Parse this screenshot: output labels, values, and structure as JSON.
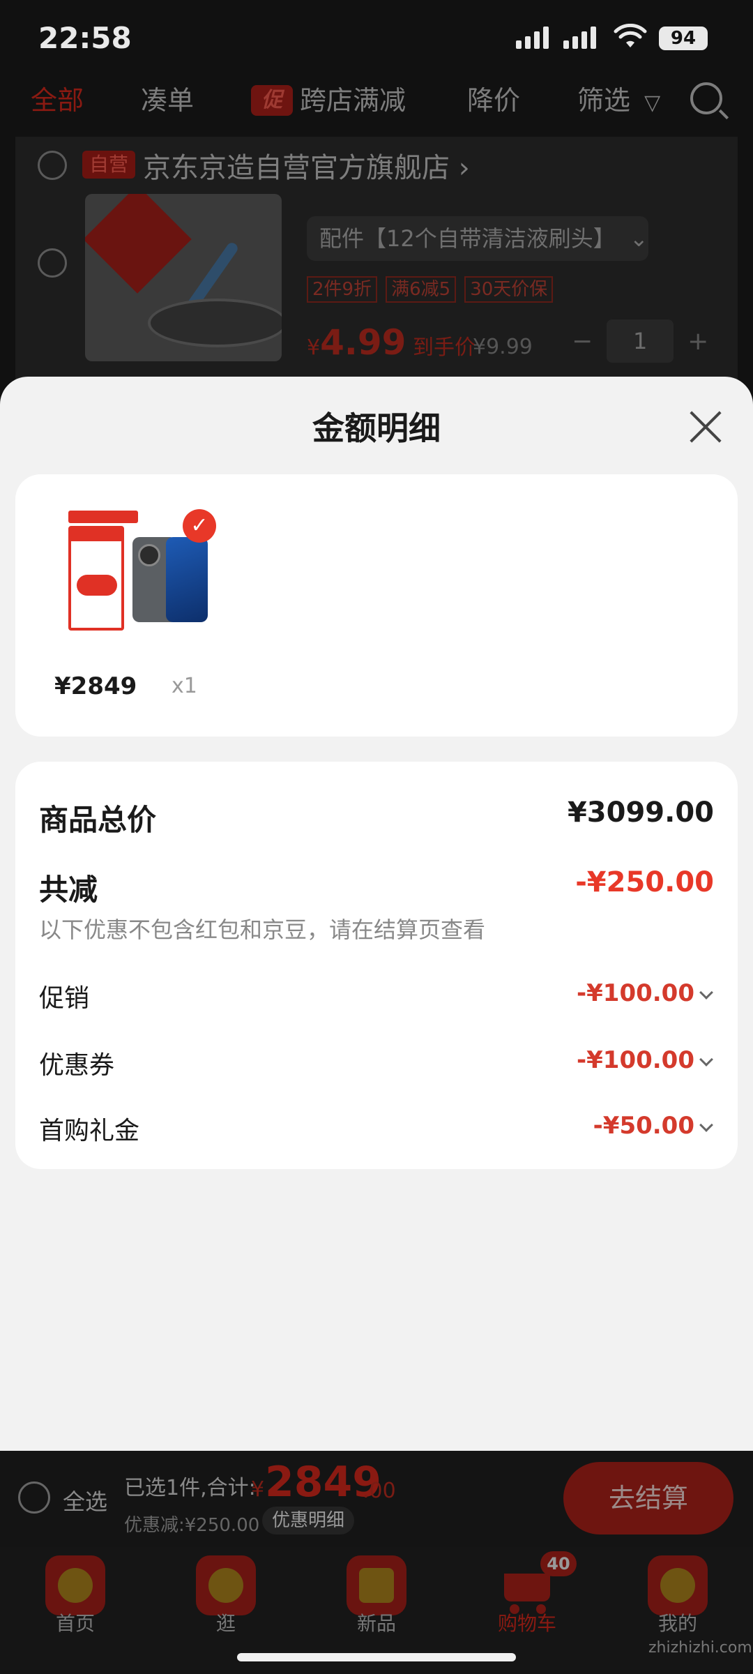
{
  "status_bar": {
    "time": "22:58",
    "battery": "94"
  },
  "top_tabs": [
    {
      "label": "全部"
    },
    {
      "label": "凑单"
    },
    {
      "label": "跨店满减",
      "tag": "促"
    },
    {
      "label": "降价"
    },
    {
      "label": "筛选"
    }
  ],
  "store": {
    "self_tag": "自营",
    "name": "京东京造自营官方旗舰店 ›",
    "product": {
      "spec": "配件【12个自带清洁液刷头】",
      "badges": [
        "2件9折",
        "满6减5",
        "30天价保"
      ],
      "price_prefix": "¥",
      "price_main": "4.99",
      "price_suffix": "到手价",
      "original_price": "¥9.99",
      "quantity": "1"
    }
  },
  "sheet": {
    "title": "金额明细",
    "item": {
      "price": "¥2849",
      "qty": "x1"
    },
    "summary": {
      "total_label": "商品总价",
      "total_value": "¥3099.00",
      "reduce_label": "共减",
      "reduce_value": "-¥250.00",
      "note": "以下优惠不包含红包和京豆，请在结算页查看",
      "rows": [
        {
          "label": "促销",
          "value": "-¥100.00"
        },
        {
          "label": "优惠券",
          "value": "-¥100.00"
        },
        {
          "label": "首购礼金",
          "value": "-¥50.00"
        }
      ]
    }
  },
  "checkout": {
    "select_all": "全选",
    "selected": "已选1件,合计:",
    "yen": "¥",
    "total_main": "2849",
    "total_decimal": ".00",
    "discount": "优惠减:¥250.00",
    "detail_button": "优惠明细",
    "checkout_button": "去结算"
  },
  "tabbar": [
    {
      "label": "首页"
    },
    {
      "label": "逛"
    },
    {
      "label": "新品"
    },
    {
      "label": "购物车",
      "badge": "40"
    },
    {
      "label": "我的"
    }
  ],
  "watermark": "zhizhizhi.com",
  "colors": {
    "accent_red": "#e83828",
    "sheet_bg": "#f2f2f2"
  }
}
